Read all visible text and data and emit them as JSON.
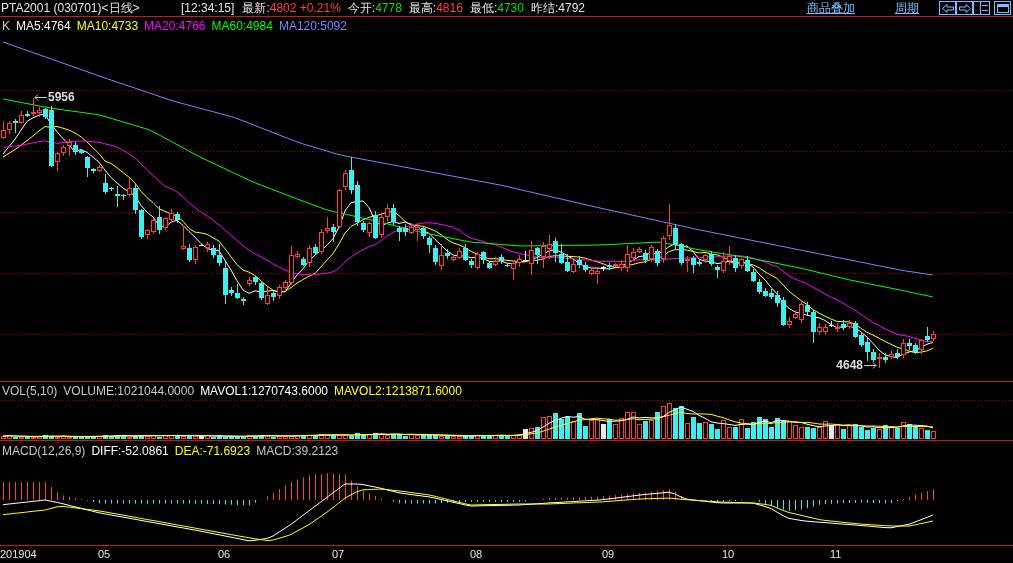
{
  "header": {
    "symbol": "PTA2001 (030701)<日线>",
    "time": "[12:34:15]",
    "quotes": [
      {
        "label": "最新:",
        "value": "4802 +0.21%",
        "color": "#ff4040"
      },
      {
        "label": "今开:",
        "value": "4778",
        "color": "#00e000"
      },
      {
        "label": "最高:",
        "value": "4816",
        "color": "#ff4040"
      },
      {
        "label": "最低:",
        "value": "4730",
        "color": "#00e000"
      },
      {
        "label": "昨结:",
        "value": "4792",
        "color": "#e6e6e6"
      }
    ],
    "links": [
      "商品叠加",
      "周期"
    ]
  },
  "price_panel": {
    "title": "K",
    "legend": [
      {
        "label": "MA5:4764",
        "color": "#ffffff"
      },
      {
        "label": "MA10:4733",
        "color": "#ffff00"
      },
      {
        "label": "MA20:4766",
        "color": "#ff00ff"
      },
      {
        "label": "MA60:4984",
        "color": "#00ff00"
      },
      {
        "label": "MA120:5092",
        "color": "#8080ff"
      }
    ],
    "high_label": "5956",
    "low_label": "4648"
  },
  "volume_panel": {
    "title": "VOL(5,10)",
    "legend": [
      {
        "label": "VOLUME:1021044.0000",
        "color": "#c8c8c8"
      },
      {
        "label": "MAVOL1:1270743.6000",
        "color": "#ffffff"
      },
      {
        "label": "MAVOL2:1213871.6000",
        "color": "#ffff00"
      }
    ]
  },
  "macd_panel": {
    "title": "MACD(12,26,9)",
    "legend": [
      {
        "label": "DIFF:-52.0861",
        "color": "#ffffff"
      },
      {
        "label": "DEA:-71.6923",
        "color": "#ffff00"
      },
      {
        "label": "MACD:39.2123",
        "color": "#c8c8c8"
      }
    ]
  },
  "x_axis": [
    "201904",
    "05",
    "06",
    "07",
    "08",
    "09",
    "10",
    "11"
  ]
}
